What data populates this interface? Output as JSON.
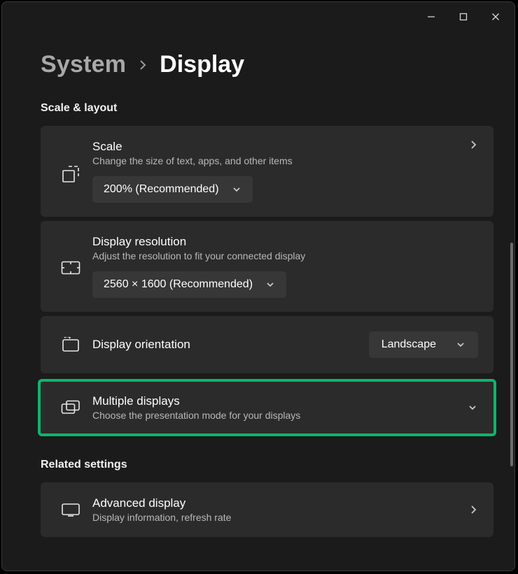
{
  "breadcrumb": {
    "parent": "System",
    "current": "Display"
  },
  "sections": {
    "scale_layout": {
      "heading": "Scale & layout",
      "scale": {
        "title": "Scale",
        "subtitle": "Change the size of text, apps, and other items",
        "value": "200% (Recommended)"
      },
      "resolution": {
        "title": "Display resolution",
        "subtitle": "Adjust the resolution to fit your connected display",
        "value": "2560 × 1600 (Recommended)"
      },
      "orientation": {
        "title": "Display orientation",
        "value": "Landscape"
      },
      "multiple": {
        "title": "Multiple displays",
        "subtitle": "Choose the presentation mode for your displays"
      }
    },
    "related": {
      "heading": "Related settings",
      "advanced": {
        "title": "Advanced display",
        "subtitle": "Display information, refresh rate"
      }
    }
  }
}
